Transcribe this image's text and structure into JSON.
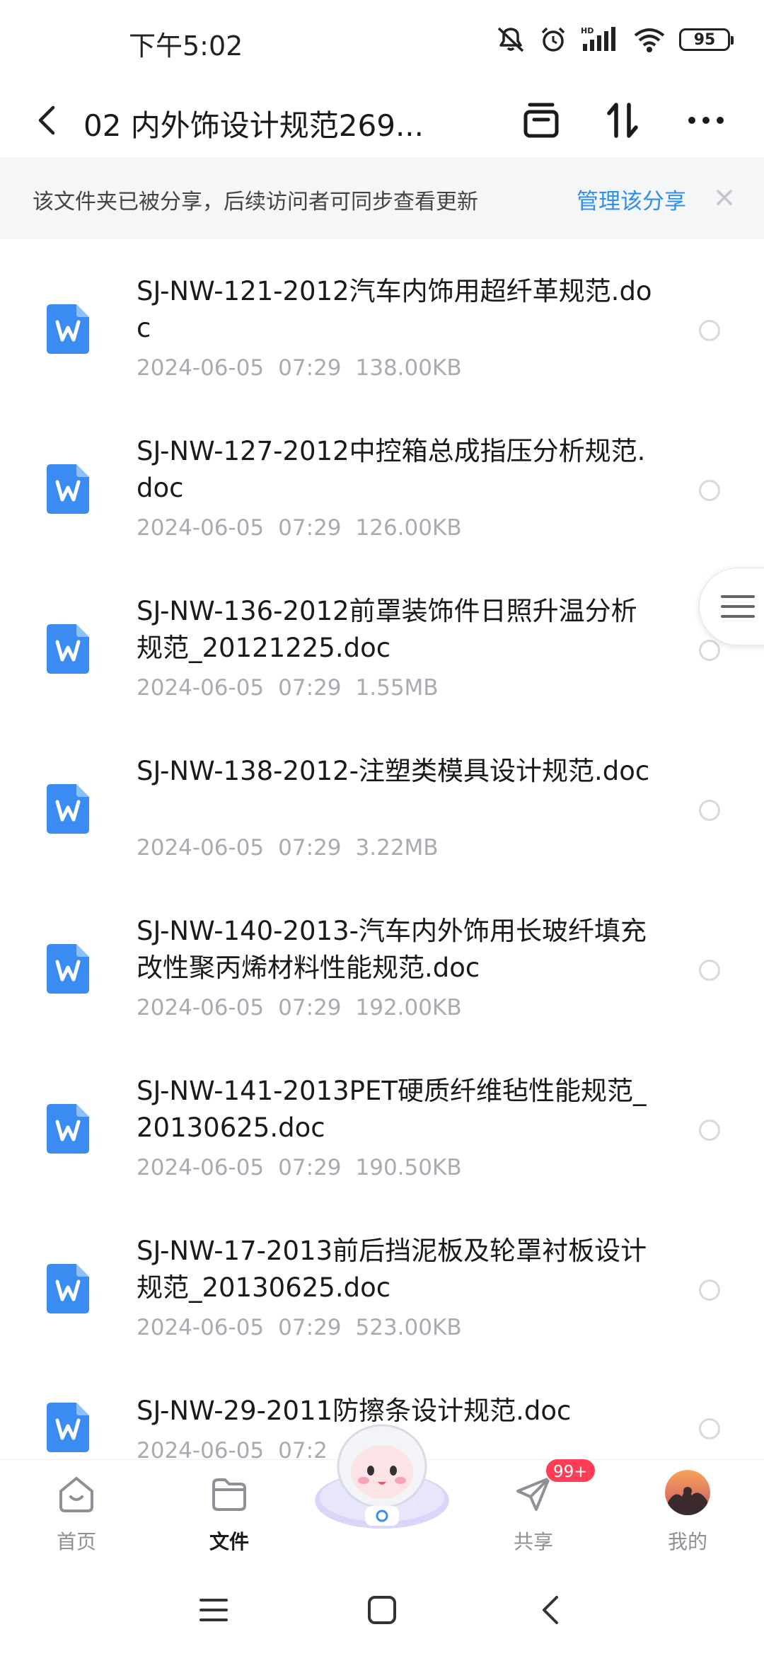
{
  "status_bar": {
    "time": "下午5:02",
    "battery": "95",
    "network": "HD",
    "icons": [
      "mute-icon",
      "alarm-icon",
      "signal-icon",
      "wifi-icon",
      "battery-icon"
    ]
  },
  "header": {
    "title": "02 内外饰设计规范269...",
    "icons": [
      "back-icon",
      "archive-icon",
      "sort-icon",
      "more-icon"
    ]
  },
  "share_banner": {
    "text": "该文件夹已被分享，后续访问者可同步查看更新",
    "link": "管理该分享",
    "close_icon": "close-icon"
  },
  "files": [
    {
      "name": "SJ-NW-121-2012汽车内饰用超纤革规范.doc",
      "date": "2024-06-05",
      "time": "07:29",
      "size": "138.00KB"
    },
    {
      "name": "SJ-NW-127-2012中控箱总成指压分析规范.doc",
      "date": "2024-06-05",
      "time": "07:29",
      "size": "126.00KB"
    },
    {
      "name": "SJ-NW-136-2012前罩装饰件日照升温分析规范_20121225.doc",
      "date": "2024-06-05",
      "time": "07:29",
      "size": "1.55MB"
    },
    {
      "name": "SJ-NW-138-2012-注塑类模具设计规范.doc",
      "date": "2024-06-05",
      "time": "07:29",
      "size": "3.22MB"
    },
    {
      "name": "SJ-NW-140-2013-汽车内外饰用长玻纤填充改性聚丙烯材料性能规范.doc",
      "date": "2024-06-05",
      "time": "07:29",
      "size": "192.00KB"
    },
    {
      "name": "SJ-NW-141-2013PET硬质纤维毡性能规范_20130625.doc",
      "date": "2024-06-05",
      "time": "07:29",
      "size": "190.50KB"
    },
    {
      "name": "SJ-NW-17-2013前后挡泥板及轮罩衬板设计规范_20130625.doc",
      "date": "2024-06-05",
      "time": "07:29",
      "size": "523.00KB"
    },
    {
      "name": "SJ-NW-29-2011防擦条设计规范.doc",
      "date": "2024-06-05",
      "time": "07:2",
      "size": ""
    }
  ],
  "bottom_nav": {
    "items": [
      {
        "label": "首页",
        "icon": "home-icon"
      },
      {
        "label": "文件",
        "icon": "folder-icon"
      },
      {
        "label": "共享",
        "icon": "share-icon"
      },
      {
        "label": "我的",
        "icon": "avatar"
      }
    ],
    "badge": "99+"
  },
  "colors": {
    "accent": "#2e8ef2",
    "word_icon": "#3a8cf3",
    "badge": "#ff3e56",
    "banner_bg": "#f5f6f8",
    "meta_text": "#a8abb1"
  }
}
